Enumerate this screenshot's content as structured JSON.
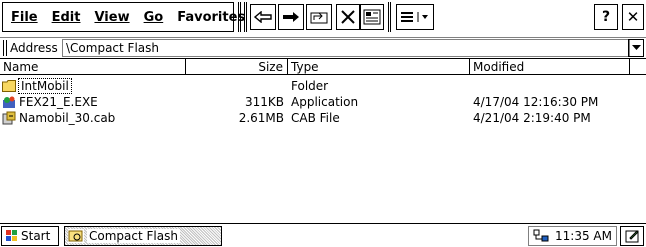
{
  "menu": {
    "items": [
      {
        "label": "File",
        "hotkey": "F"
      },
      {
        "label": "Edit",
        "hotkey": "E"
      },
      {
        "label": "View",
        "hotkey": "V"
      },
      {
        "label": "Go",
        "hotkey": "G"
      },
      {
        "label": "Favorites",
        "hotkey": "a"
      }
    ]
  },
  "toolbar": {
    "buttons": [
      {
        "name": "back-button",
        "icon": "arrow-left-icon"
      },
      {
        "name": "forward-button",
        "icon": "arrow-right-icon"
      },
      {
        "name": "up-folder-button",
        "icon": "up-folder-icon"
      },
      {
        "name": "delete-button",
        "icon": "delete-x-icon"
      },
      {
        "name": "properties-button",
        "icon": "properties-icon"
      },
      {
        "name": "view-mode-button",
        "icon": "view-list-icon"
      }
    ],
    "help_label": "?",
    "close_label": "✕"
  },
  "address": {
    "label": "Address",
    "value": "\\Compact Flash"
  },
  "columns": [
    "Name",
    "Size",
    "Type",
    "Modified"
  ],
  "files": [
    {
      "name": "IntMobil",
      "size": "",
      "type": "Folder",
      "modified": "",
      "icon": "folder-icon"
    },
    {
      "name": "FEX21_E.EXE",
      "size": "311KB",
      "type": "Application",
      "modified": "4/17/04 12:16:30 PM",
      "icon": "application-icon"
    },
    {
      "name": "Namobil_30.cab",
      "size": "2.61MB",
      "type": "CAB File",
      "modified": "4/21/04 2:19:40 PM",
      "icon": "cab-file-icon"
    }
  ],
  "taskbar": {
    "start_label": "Start",
    "task_label": "Compact Flash",
    "clock": "11:35 AM"
  },
  "colors": {
    "folder": "#f8d860",
    "selection_border": "#000000"
  }
}
